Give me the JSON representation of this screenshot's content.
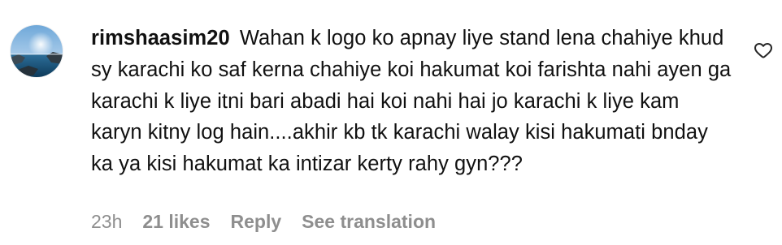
{
  "comment": {
    "username": "rimshaasim20",
    "text": "Wahan k logo ko apnay liye stand lena chahiye khud sy karachi ko saf kerna chahiye koi hakumat koi farishta nahi ayen ga karachi k liye itni bari abadi hai koi nahi hai jo karachi k liye kam karyn kitny log hain....akhir kb tk karachi walay kisi hakumati bnday ka ya kisi hakumat ka intizar kerty rahy gyn???",
    "timestamp": "23h",
    "likes": "21 likes",
    "reply_label": "Reply",
    "translation_label": "See translation",
    "like_icon": "heart-outline-icon",
    "avatar": "profile-avatar"
  },
  "colors": {
    "text": "#111111",
    "meta": "#8e8e8e",
    "background": "#ffffff"
  }
}
